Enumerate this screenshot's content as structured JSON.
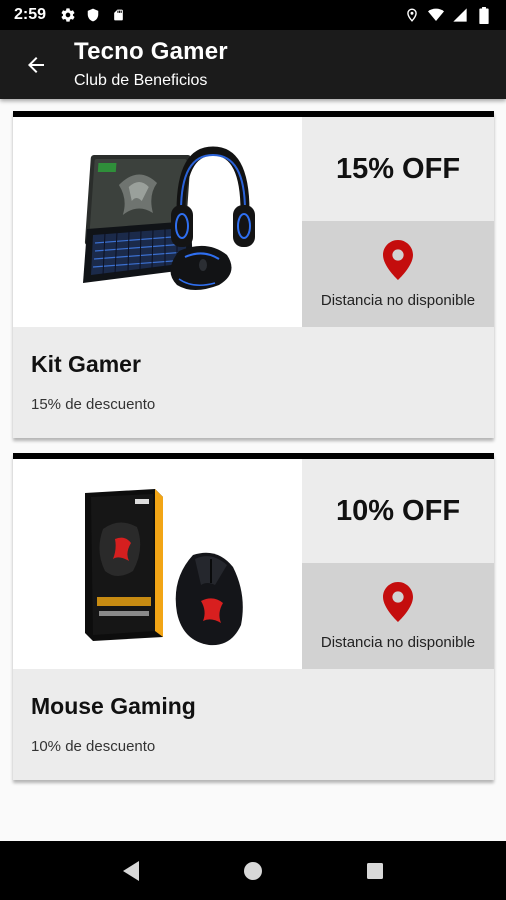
{
  "status_bar": {
    "time": "2:59",
    "left_icons": [
      "gear-icon",
      "shield-icon",
      "sd-card-icon"
    ],
    "right_icons": [
      "location-icon",
      "wifi-icon",
      "signal-icon",
      "battery-icon"
    ]
  },
  "app_bar": {
    "title": "Tecno Gamer",
    "subtitle": "Club de Beneficios",
    "back_icon": "arrow-back-icon"
  },
  "offers": [
    {
      "name": "Kit Gamer",
      "description": "15% de descuento",
      "discount": "15% OFF",
      "distance": "Distancia no disponible",
      "image": "gaming-kit-product-image"
    },
    {
      "name": "Mouse Gaming",
      "description": "10% de descuento",
      "discount": "10% OFF",
      "distance": "Distancia no disponible",
      "image": "gaming-mouse-product-image"
    }
  ],
  "colors": {
    "status_bar": "#000000",
    "app_bar": "#1b1b1b",
    "card_background": "#ececec",
    "distance_background": "#d2d2d2",
    "pin": "#c40d0d",
    "page_background": "#fafafa"
  },
  "nav_bar": {
    "buttons": [
      "back-triangle-icon",
      "home-circle-icon",
      "recents-square-icon"
    ]
  }
}
